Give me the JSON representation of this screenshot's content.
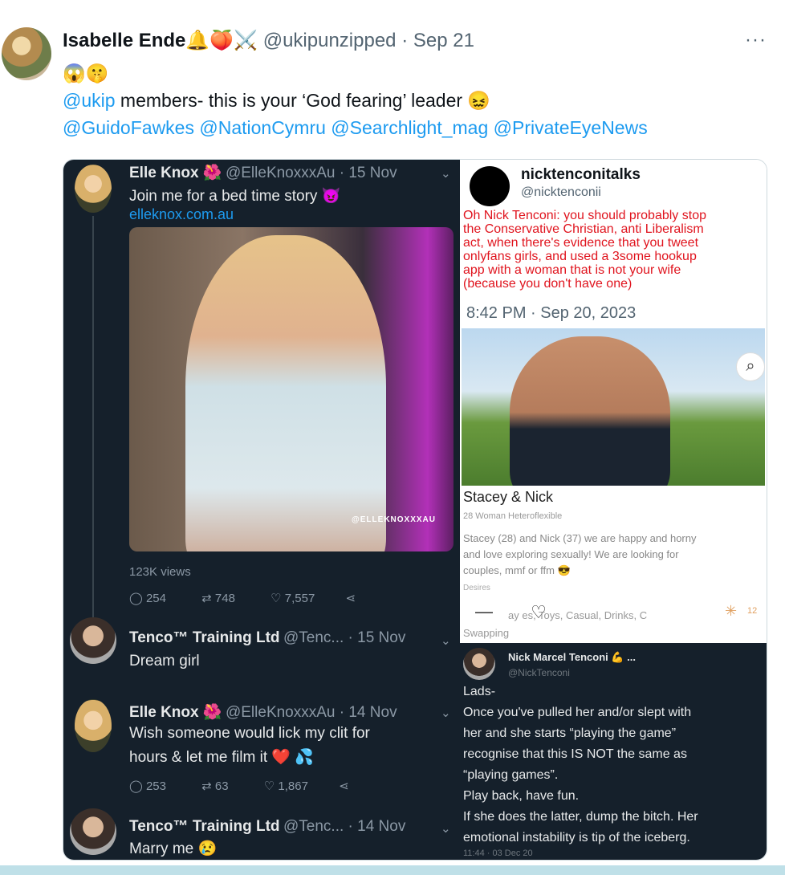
{
  "tweet": {
    "author_name": "Isabelle Ende🔔🍑⚔️",
    "meta": "@ukipunzipped · Sep 21",
    "more": "···",
    "line1": "😱🤫",
    "line2_mention": "@ukip",
    "line2_rest": " members- this is your ‘God fearing’ leader 😖",
    "line3": "@GuidoFawkes @NationCymru @Searchlight_mag @PrivateEyeNews"
  },
  "left": {
    "t1": {
      "name": "Elle Knox 🌺",
      "handle": "@ElleKnoxxxAu · 15 Nov",
      "text": "Join me for a bed time story 😈",
      "link": "elleknox.com.au",
      "watermark": "@ELLEKNOXXXAU",
      "views": "123K views",
      "replies": "254",
      "retweets": "748",
      "likes": "7,557"
    },
    "t2": {
      "name": "Tenco™ Training Ltd",
      "handle": "@Tenc... · 15 Nov",
      "text": "Dream girl"
    },
    "t3": {
      "name": "Elle Knox 🌺",
      "handle": "@ElleKnoxxxAu · 14 Nov",
      "text1": "Wish someone would lick my clit for",
      "text2": "hours & let me film it ❤️ 💦",
      "replies": "253",
      "retweets": "63",
      "likes": "1,867"
    },
    "t4": {
      "name": "Tenco™ Training Ltd",
      "handle": "@Tenc... · 14 Nov",
      "text": "Marry me 😢"
    }
  },
  "right": {
    "name": "nicktenconitalks",
    "handle": "@nicktenconii",
    "red_lines": [
      "Oh Nick Tenconi: you should probably stop",
      "the Conservative Christian, anti Liberalism",
      "act, when there's evidence that you tweet",
      "onlyfans girls, and used a 3some hookup",
      "app with a woman that is not your wife",
      "(because you don't have one)"
    ],
    "time": "8:42 PM · Sep 20, 2023",
    "profile_title": "Stacey & Nick",
    "profile_sub": "28 Woman Heteroflexible",
    "profile_lines": [
      "Stacey (28) and Nick (37) we are happy and horny",
      "and love exploring sexually! We are looking for",
      "couples, mmf or ffm 😎"
    ],
    "desires": "Desires",
    "tags": "ay   es, Toys, Casual, Drinks, C",
    "swapping": "Swapping",
    "count": "12",
    "nick_name": "Nick Marcel Tenconi 💪 ...",
    "nick_handle": "@NickTenconi",
    "nick_lines": [
      "Lads-",
      "Once you've pulled her and/or slept with",
      "her and she starts “playing the game”",
      "recognise that this IS NOT the same as",
      "“playing games”.",
      "Play back, have fun.",
      "If she does the latter, dump the bitch. Her",
      "emotional instability is tip of the iceberg.",
      "11:44 · 03 Dec 20"
    ]
  },
  "icons": {
    "reply": "reply-icon",
    "retweet": "retweet-icon",
    "like": "heart-icon",
    "share": "share-icon",
    "search": "search-icon"
  }
}
